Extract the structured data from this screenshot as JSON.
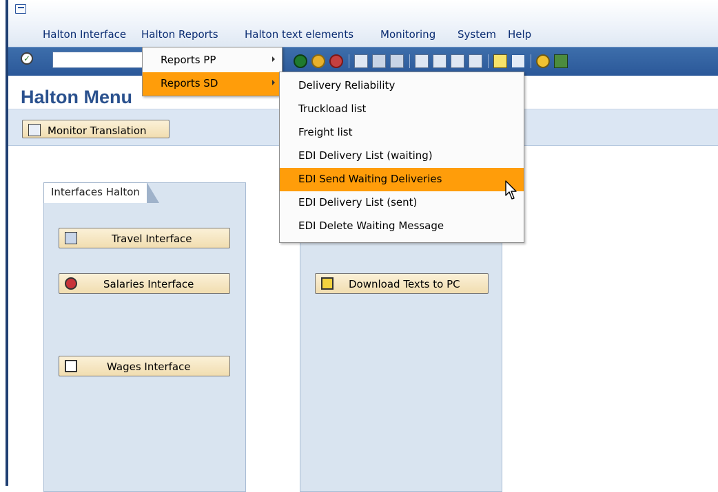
{
  "menubar": {
    "items": [
      {
        "label": "Halton Interface"
      },
      {
        "label": "Halton Reports"
      },
      {
        "label": "Halton text elements"
      },
      {
        "label": "Monitoring"
      },
      {
        "label": "System"
      },
      {
        "label": "Help"
      }
    ]
  },
  "toolbar": {
    "command_field_value": "",
    "icons": [
      "ok-icon",
      "back-icon",
      "exit-icon",
      "cancel-icon",
      "print-icon",
      "find-icon",
      "find-next-icon",
      "first-page-icon",
      "previous-page-icon",
      "next-page-icon",
      "last-page-icon",
      "create-session-icon",
      "shortcut-icon",
      "help-icon",
      "layout-menu-icon"
    ]
  },
  "page": {
    "title": "Halton Menu"
  },
  "app_toolbar": {
    "monitor_translation": "Monitor Translation"
  },
  "panels": {
    "interfaces": {
      "tab": "Interfaces Halton",
      "buttons": [
        "Travel Interface",
        "Salaries Interface",
        "Wages Interface"
      ]
    },
    "texts": {
      "buttons": [
        "Download Texts to PC"
      ]
    }
  },
  "reports_menu": {
    "items": [
      {
        "label": "Reports PP",
        "highlighted": false
      },
      {
        "label": "Reports SD",
        "highlighted": true
      }
    ]
  },
  "reports_sd_submenu": {
    "items": [
      {
        "label": "Delivery Reliability"
      },
      {
        "label": "Truckload list"
      },
      {
        "label": "Freight list"
      },
      {
        "label": "EDI Delivery List (waiting)"
      },
      {
        "label": "EDI Send Waiting Deliveries",
        "highlighted": true
      },
      {
        "label": "EDI Delivery List (sent)"
      },
      {
        "label": "EDI Delete Waiting Message"
      }
    ]
  },
  "colors": {
    "highlight": "#ff9d0a",
    "toolbar_blue": "#2b5899",
    "title_blue": "#2a518e"
  }
}
